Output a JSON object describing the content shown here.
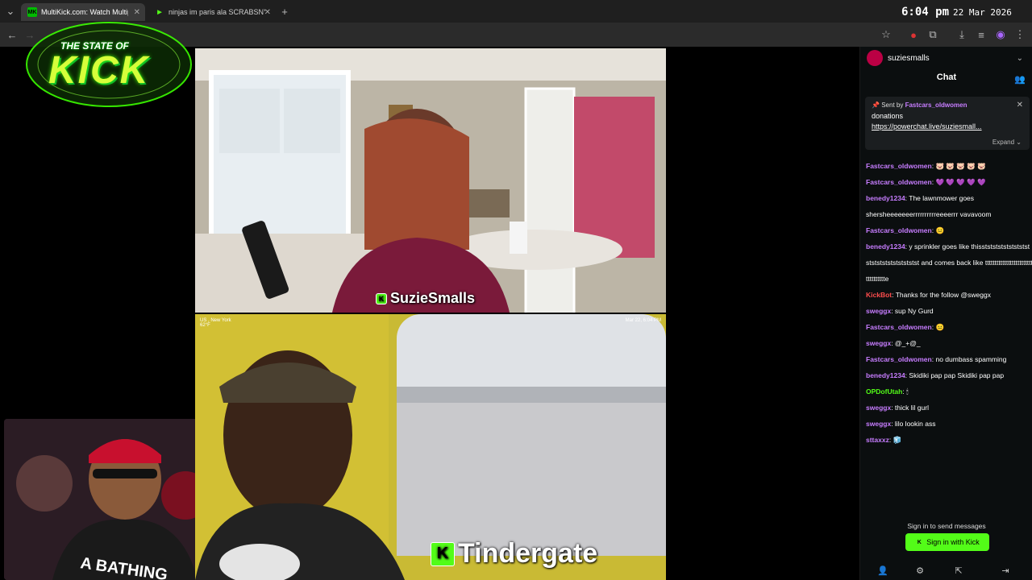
{
  "tabs": [
    {
      "favicon": "MK",
      "title": "MultiKick.com: Watch Multiple",
      "active": true
    },
    {
      "favicon": "▶",
      "title": "ninjas im paris ala SCRABSNYC",
      "active": false
    }
  ],
  "clock": {
    "time": "6:04 pm",
    "date": "22 Mar 2026"
  },
  "logo": {
    "top": "THE STATE OF",
    "main": "KICK"
  },
  "streams": [
    {
      "name": "SuzieSmalls",
      "badge": "K"
    },
    {
      "name": "Tindergate",
      "badge": "K",
      "overlay_location": "US , New York",
      "overlay_temp": "62°F",
      "overlay_time": "Mar 22, 6:04 PM"
    }
  ],
  "chat": {
    "channel": "suziesmalls",
    "title": "Chat",
    "pinned": {
      "sent_by": "Sent by",
      "user": "Fastcars_oldwomen",
      "line1": "donations",
      "line2": "https://powerchat.live/suziesmall...",
      "expand": "Expand"
    },
    "messages": [
      {
        "user": "Fastcars_oldwomen",
        "color": "#c77dff",
        "text": "🐷 🐷 🐷 🐷 🐷"
      },
      {
        "user": "Fastcars_oldwomen",
        "color": "#c77dff",
        "text": "💜 💜 💜 💜 💜"
      },
      {
        "user": "benedy1234",
        "color": "#c77dff",
        "text": "The lawnmower goes shersheeeeeeerrrrrrrrrreeeerrr vavavoom"
      },
      {
        "user": "Fastcars_oldwomen",
        "color": "#c77dff",
        "text": "😐"
      },
      {
        "user": "benedy1234",
        "color": "#c77dff",
        "text": "y sprinkler goes like thisststststststststststststststststststst and comes back like ttttttttttttttttttttttttttttttttttte"
      },
      {
        "user": "KickBot",
        "color": "#ff4d4d",
        "text": "Thanks for the follow @sweggx"
      },
      {
        "user": "sweggx",
        "color": "#c77dff",
        "text": "sup Ny Gurd"
      },
      {
        "user": "Fastcars_oldwomen",
        "color": "#c77dff",
        "text": "😐"
      },
      {
        "user": "sweggx",
        "color": "#c77dff",
        "text": "@_+@_"
      },
      {
        "user": "Fastcars_oldwomen",
        "color": "#c77dff",
        "text": "no dumbass spamming"
      },
      {
        "user": "benedy1234",
        "color": "#c77dff",
        "text": "Skidiki pap pap Skidiki pap pap"
      },
      {
        "user": "OPDofUtah",
        "color": "#53fc18",
        "text": "🕯"
      },
      {
        "user": "sweggx",
        "color": "#c77dff",
        "text": "thick lil gurl"
      },
      {
        "user": "sweggx",
        "color": "#c77dff",
        "text": "lilo lookin ass"
      },
      {
        "user": "sttaxxz",
        "color": "#c77dff",
        "text": "🧊"
      }
    ],
    "signin_prompt": "Sign in to send messages",
    "signin_button": "Sign in with Kick"
  }
}
